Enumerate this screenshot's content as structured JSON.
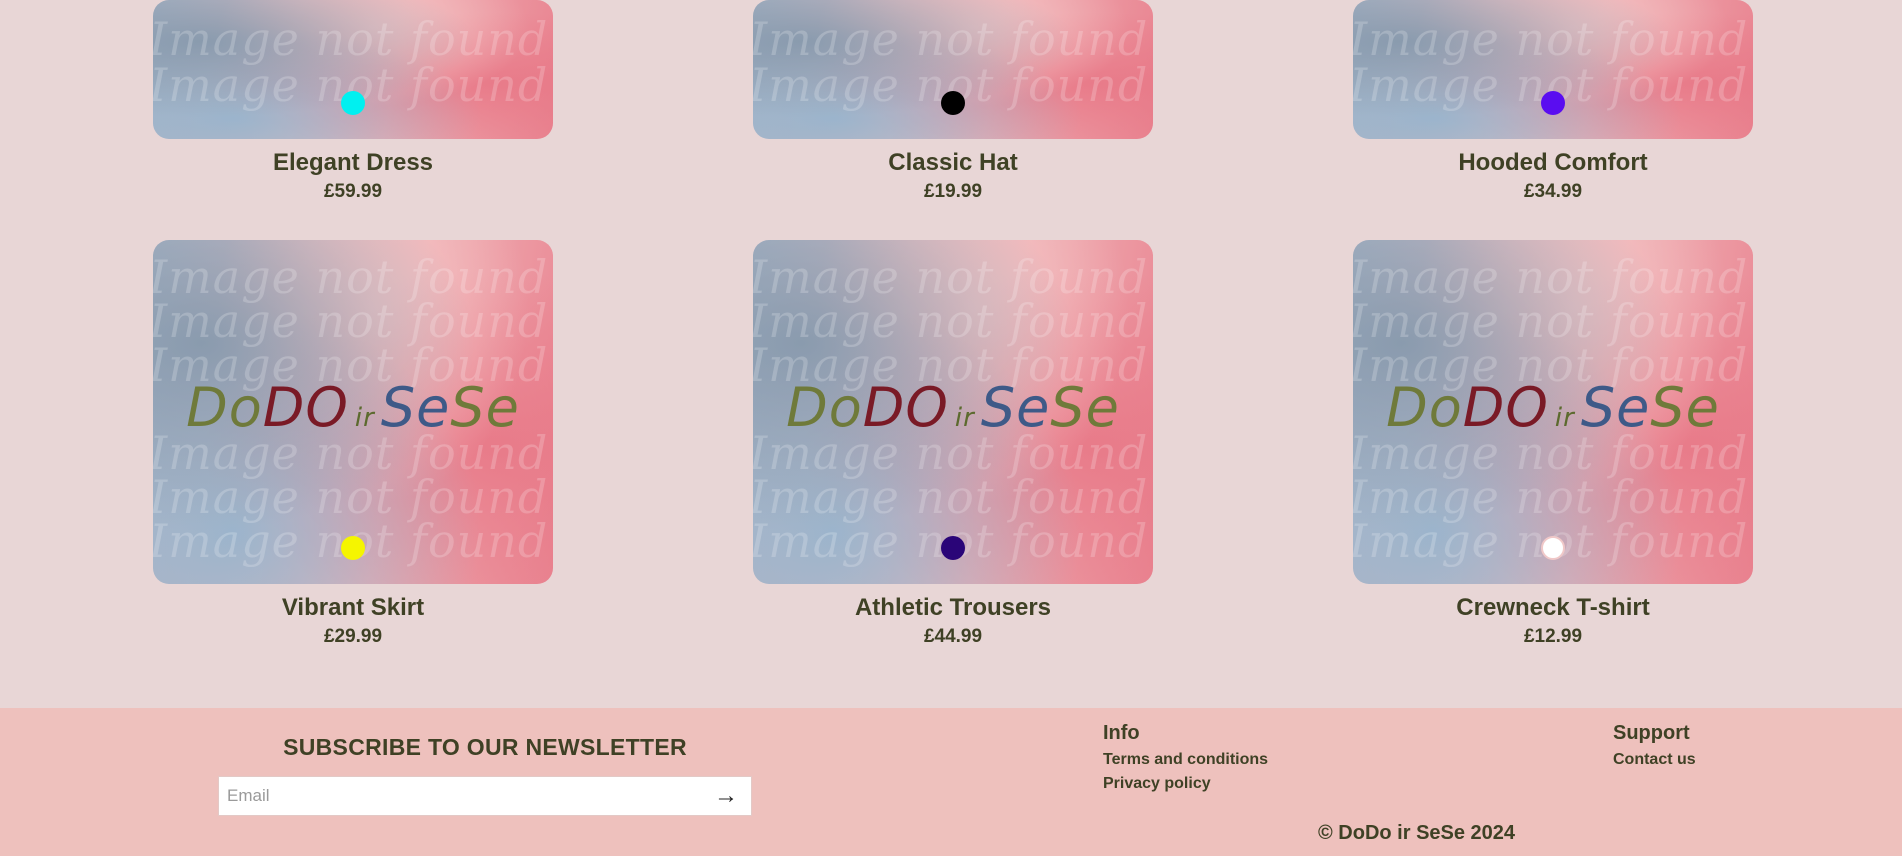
{
  "products": [
    {
      "name": "Elegant Dress",
      "price": "£59.99",
      "swatch_color": "#00f0f0"
    },
    {
      "name": "Classic Hat",
      "price": "£19.99",
      "swatch_color": "#000000"
    },
    {
      "name": "Hooded Comfort",
      "price": "£34.99",
      "swatch_color": "#5a0df0"
    },
    {
      "name": "Vibrant Skirt",
      "price": "£29.99",
      "swatch_color": "#f5f500"
    },
    {
      "name": "Athletic Trousers",
      "price": "£44.99",
      "swatch_color": "#2a0578"
    },
    {
      "name": "Crewneck T-shirt",
      "price": "£12.99",
      "swatch_color": "#ffffff"
    }
  ],
  "placeholder_image": {
    "watermark_text": "Image not found",
    "logo": {
      "part1": "Do",
      "part2": "DO",
      "connector": "ir",
      "part3": "Se",
      "part4": "Se"
    }
  },
  "footer": {
    "newsletter": {
      "title": "SUBSCRIBE TO OUR NEWSLETTER",
      "placeholder": "Email",
      "submit_icon": "arrow-right-icon",
      "submit_glyph": "→"
    },
    "info": {
      "title": "Info",
      "links": [
        "Terms and conditions",
        "Privacy policy"
      ]
    },
    "support": {
      "title": "Support",
      "links": [
        "Contact us"
      ]
    },
    "copyright": "© DoDo ir SeSe 2024"
  },
  "colors": {
    "page_background": "#e8d6d6",
    "footer_background": "#eec1bd",
    "text": "#3f4125"
  }
}
